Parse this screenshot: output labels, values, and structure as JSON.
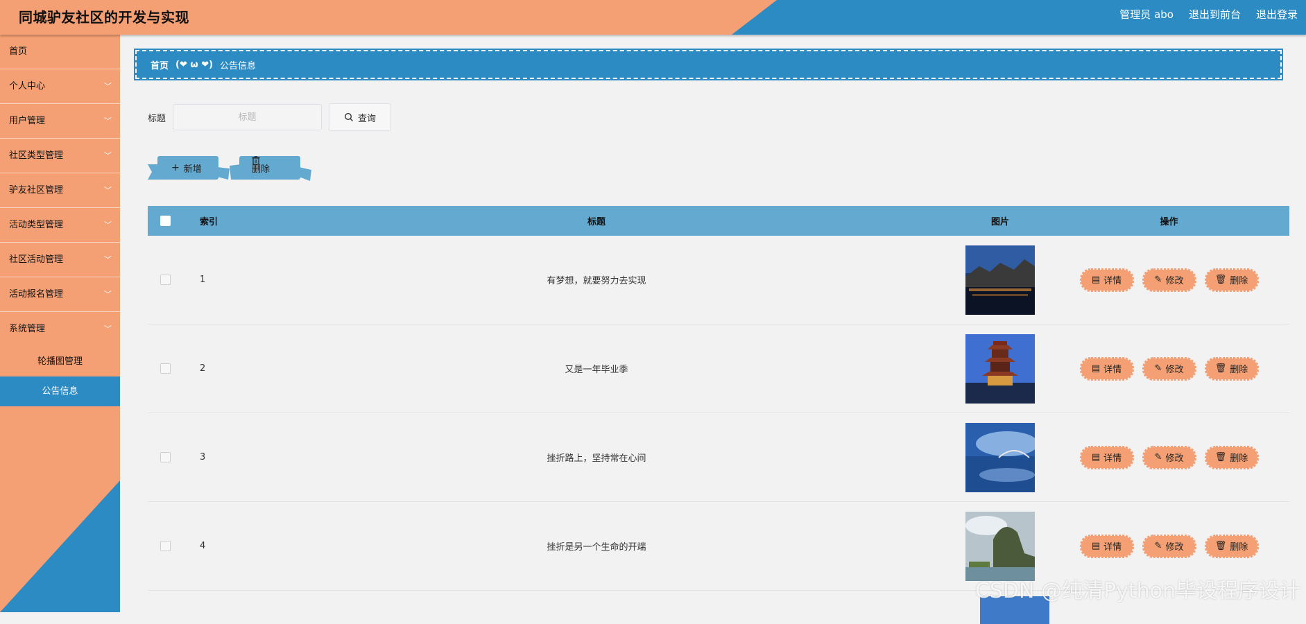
{
  "header": {
    "title": "同城驴友社区的开发与实现",
    "user": "管理员 abo",
    "front_link": "退出到前台",
    "logout": "退出登录"
  },
  "sidebar": {
    "items": [
      {
        "label": "首页"
      },
      {
        "label": "个人中心"
      },
      {
        "label": "用户管理"
      },
      {
        "label": "社区类型管理"
      },
      {
        "label": "驴友社区管理"
      },
      {
        "label": "活动类型管理"
      },
      {
        "label": "社区活动管理"
      },
      {
        "label": "活动报名管理"
      },
      {
        "label": "系统管理"
      }
    ],
    "sub_items": [
      {
        "label": "轮播图管理"
      },
      {
        "label": "公告信息"
      }
    ]
  },
  "breadcrumb": {
    "home": "首页",
    "face": "(❤ ω ❤)",
    "current": "公告信息"
  },
  "search": {
    "label": "标题",
    "placeholder": "标题",
    "button": "查询"
  },
  "actions": {
    "add": "新增",
    "delete": "删除"
  },
  "table": {
    "columns": [
      "索引",
      "标题",
      "图片",
      "操作"
    ],
    "rows": [
      {
        "index": "1",
        "title": "有梦想，就要努力去实现"
      },
      {
        "index": "2",
        "title": "又是一年毕业季"
      },
      {
        "index": "3",
        "title": "挫折路上，坚持常在心间"
      },
      {
        "index": "4",
        "title": "挫折是另一个生命的开端"
      }
    ],
    "ops": {
      "detail": "详情",
      "edit": "修改",
      "delete": "删除"
    }
  },
  "watermark": "CSDN @纯清Python毕设程序设计",
  "colors": {
    "accent_orange": "#f4a074",
    "accent_blue": "#2b8bc2",
    "table_header": "#64a9cf",
    "ribbon_blue": "#64a9cf",
    "op_button": "#f4a074"
  }
}
